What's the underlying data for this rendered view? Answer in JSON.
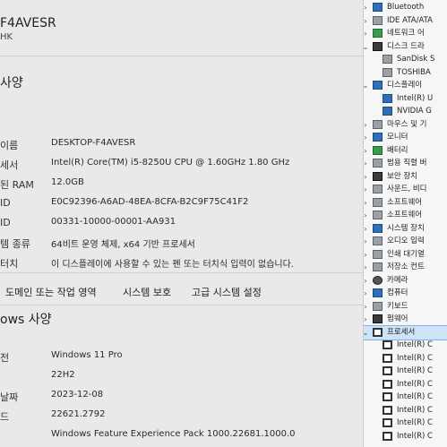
{
  "about": {
    "device_name_header": "F4AVESR",
    "device_sub": "HK",
    "device_spec_title": "사양",
    "specs": [
      {
        "label": "이름",
        "value": "DESKTOP-F4AVESR"
      },
      {
        "label": "세서",
        "value": "Intel(R) Core(TM) i5-8250U CPU @ 1.60GHz   1.80 GHz"
      },
      {
        "label": "된 RAM",
        "value": "12.0GB"
      },
      {
        "label": "ID",
        "value": "E0C92396-A6AD-48EA-8CFA-B2C9F75C41F2"
      },
      {
        "label": "ID",
        "value": "00331-10000-00001-AA931"
      },
      {
        "label": "템 종류",
        "value": "64비트 운영 체제, x64 기반 프로세서"
      },
      {
        "label": "터치",
        "value": "이 디스플레이에 사용할 수 있는 펜 또는 터치식 입력이 없습니다."
      }
    ],
    "links": [
      "도메인 또는 작업 영역",
      "시스템 보호",
      "고급 시스템 설정"
    ],
    "windows_spec_title": "ows 사양",
    "win_specs": [
      {
        "label": "전",
        "value": "Windows 11 Pro"
      },
      {
        "label": "",
        "value": "22H2"
      },
      {
        "label": "날짜",
        "value": "2023-12-08"
      },
      {
        "label": "드",
        "value": "22621.2792"
      },
      {
        "label": "",
        "value": "Windows Feature Experience Pack 1000.22681.1000.0"
      }
    ]
  },
  "devmgr": {
    "nodes": [
      {
        "label": "Bluetooth",
        "chev": "›",
        "indent": 0,
        "icon": "bluetooth-icon",
        "color": "ico-blue"
      },
      {
        "label": "IDE ATA/ATA",
        "chev": "›",
        "indent": 0,
        "icon": "ide-controller-icon",
        "color": "ico-gray"
      },
      {
        "label": "네트워크 어",
        "chev": "›",
        "indent": 0,
        "icon": "network-adapter-icon",
        "color": "ico-green"
      },
      {
        "label": "디스크 드라",
        "chev": "⌄",
        "indent": 0,
        "icon": "disk-drive-icon",
        "color": "ico-dark"
      },
      {
        "label": "SanDisk S",
        "chev": "",
        "indent": 1,
        "icon": "disk-icon",
        "color": "ico-gray"
      },
      {
        "label": "TOSHIBA",
        "chev": "",
        "indent": 1,
        "icon": "disk-icon",
        "color": "ico-gray"
      },
      {
        "label": "디스플레이",
        "chev": "⌄",
        "indent": 0,
        "icon": "display-adapter-icon",
        "color": "ico-blue"
      },
      {
        "label": "Intel(R) U",
        "chev": "",
        "indent": 1,
        "icon": "display-icon",
        "color": "ico-blue"
      },
      {
        "label": "NVIDIA G",
        "chev": "",
        "indent": 1,
        "icon": "display-icon",
        "color": "ico-blue"
      },
      {
        "label": "마우스 및 기",
        "chev": "›",
        "indent": 0,
        "icon": "mouse-icon",
        "color": "ico-gray"
      },
      {
        "label": "모니터",
        "chev": "›",
        "indent": 0,
        "icon": "monitor-icon",
        "color": "ico-blue"
      },
      {
        "label": "배터리",
        "chev": "›",
        "indent": 0,
        "icon": "battery-icon",
        "color": "ico-green"
      },
      {
        "label": "범용 직렬 버",
        "chev": "›",
        "indent": 0,
        "icon": "usb-icon",
        "color": "ico-gray"
      },
      {
        "label": "보안 장치",
        "chev": "›",
        "indent": 0,
        "icon": "security-device-icon",
        "color": "ico-dark"
      },
      {
        "label": "사운드, 비디",
        "chev": "›",
        "indent": 0,
        "icon": "sound-icon",
        "color": "ico-gray"
      },
      {
        "label": "소프트웨어",
        "chev": "›",
        "indent": 0,
        "icon": "software-component-icon",
        "color": "ico-gray"
      },
      {
        "label": "소프트웨어",
        "chev": "›",
        "indent": 0,
        "icon": "software-device-icon",
        "color": "ico-gray"
      },
      {
        "label": "시스템 장치",
        "chev": "›",
        "indent": 0,
        "icon": "system-device-icon",
        "color": "ico-blue"
      },
      {
        "label": "오디오 입력",
        "chev": "›",
        "indent": 0,
        "icon": "audio-io-icon",
        "color": "ico-gray"
      },
      {
        "label": "인쇄 대기열",
        "chev": "›",
        "indent": 0,
        "icon": "print-queue-icon",
        "color": "ico-gray"
      },
      {
        "label": "저장소 컨트",
        "chev": "›",
        "indent": 0,
        "icon": "storage-controller-icon",
        "color": "ico-gray"
      },
      {
        "label": "카메라",
        "chev": "›",
        "indent": 0,
        "icon": "camera-icon",
        "color": "ico-cam"
      },
      {
        "label": "컴퓨터",
        "chev": "›",
        "indent": 0,
        "icon": "computer-icon",
        "color": "ico-blue"
      },
      {
        "label": "키보드",
        "chev": "›",
        "indent": 0,
        "icon": "keyboard-icon",
        "color": "ico-gray"
      },
      {
        "label": "펌웨어",
        "chev": "›",
        "indent": 0,
        "icon": "firmware-icon",
        "color": "ico-dark"
      },
      {
        "label": "프로세서",
        "chev": "⌄",
        "indent": 0,
        "icon": "processor-icon",
        "color": "ico-chip",
        "selected": true
      },
      {
        "label": "Intel(R) C",
        "chev": "",
        "indent": 1,
        "icon": "cpu-icon",
        "color": "ico-chip"
      },
      {
        "label": "Intel(R) C",
        "chev": "",
        "indent": 1,
        "icon": "cpu-icon",
        "color": "ico-chip"
      },
      {
        "label": "Intel(R) C",
        "chev": "",
        "indent": 1,
        "icon": "cpu-icon",
        "color": "ico-chip"
      },
      {
        "label": "Intel(R) C",
        "chev": "",
        "indent": 1,
        "icon": "cpu-icon",
        "color": "ico-chip"
      },
      {
        "label": "Intel(R) C",
        "chev": "",
        "indent": 1,
        "icon": "cpu-icon",
        "color": "ico-chip"
      },
      {
        "label": "Intel(R) C",
        "chev": "",
        "indent": 1,
        "icon": "cpu-icon",
        "color": "ico-chip"
      },
      {
        "label": "Intel(R) C",
        "chev": "",
        "indent": 1,
        "icon": "cpu-icon",
        "color": "ico-chip"
      },
      {
        "label": "Intel(R) C",
        "chev": "",
        "indent": 1,
        "icon": "cpu-icon",
        "color": "ico-chip"
      }
    ]
  }
}
